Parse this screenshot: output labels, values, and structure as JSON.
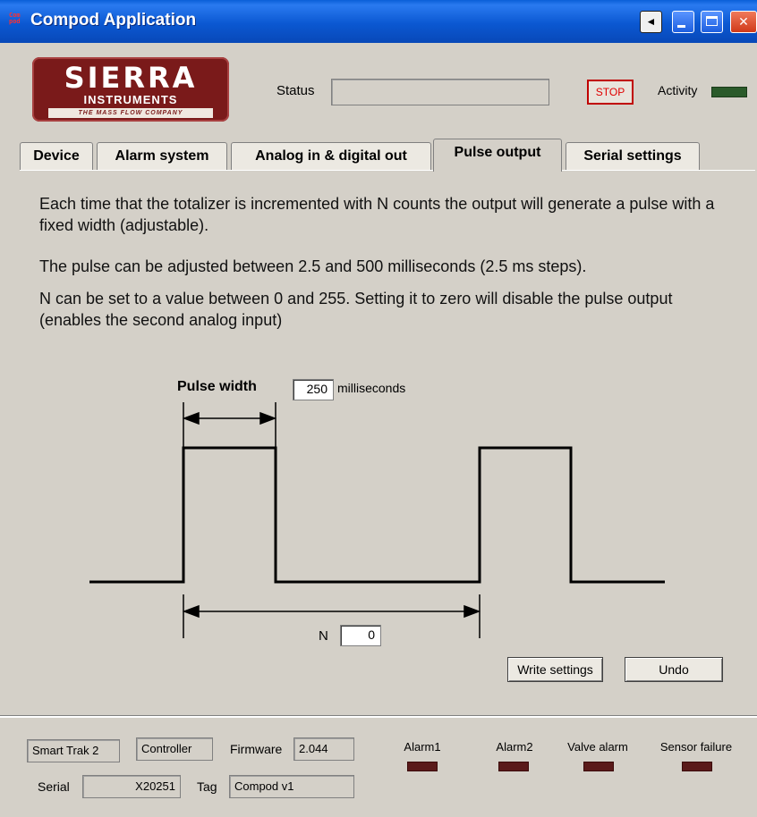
{
  "window": {
    "title": "Compod Application",
    "icon_text": "Com pod",
    "help_glyph": "◄",
    "minimize_glyph": "",
    "maximize_glyph": "",
    "close_glyph": "✕"
  },
  "header": {
    "logo": {
      "line1": "SIERRA",
      "line2": "INSTRUMENTS",
      "line3": "THE MASS FLOW COMPANY"
    },
    "status_label": "Status",
    "status_value": "",
    "stop_label": "STOP",
    "activity_label": "Activity",
    "colors": {
      "stop_text": "#e00000",
      "activity_led": "#2a5a2a"
    }
  },
  "tabs": [
    {
      "label": "Device",
      "active": false
    },
    {
      "label": "Alarm system",
      "active": false
    },
    {
      "label": "Analog in & digital out",
      "active": false
    },
    {
      "label": "Pulse output",
      "active": true
    },
    {
      "label": "Serial settings",
      "active": false
    }
  ],
  "pulse": {
    "desc1": "Each time that the totalizer is incremented with N counts the output will generate a pulse with a fixed width (adjustable).",
    "desc2": "The pulse can be adjusted between 2.5 and 500 milliseconds (2.5 ms steps).",
    "desc3": "N can be set to a value between 0 and 255. Setting it to zero will disable the pulse output (enables the second analog input)",
    "pulse_width_label": "Pulse width",
    "pulse_width_value": "250",
    "ms_label": "milliseconds",
    "n_label": "N",
    "n_value": "0",
    "write_label": "Write settings",
    "undo_label": "Undo"
  },
  "footer": {
    "model": "Smart Trak 2",
    "mode": "Controller",
    "firmware_label": "Firmware",
    "firmware_value": "2.044",
    "serial_label": "Serial",
    "serial_value": "X20251",
    "tag_label": "Tag",
    "tag_value": "Compod v1",
    "alarms": [
      {
        "label": "Alarm1"
      },
      {
        "label": "Alarm2"
      },
      {
        "label": "Valve alarm"
      },
      {
        "label": "Sensor failure"
      }
    ],
    "colors": {
      "alarm_led": "#5a1a1a"
    }
  }
}
